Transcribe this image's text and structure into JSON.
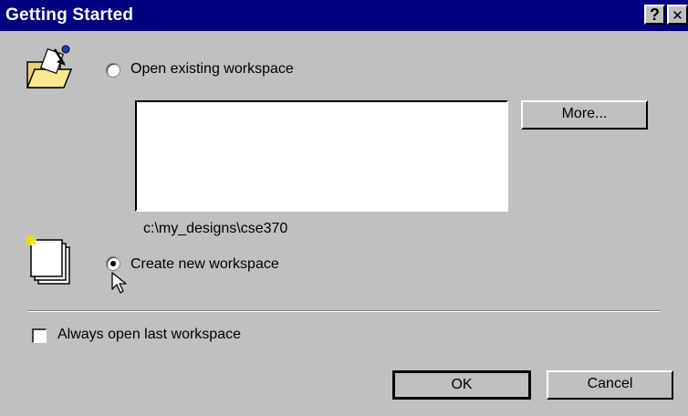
{
  "window": {
    "title": "Getting Started",
    "help_glyph": "?",
    "close_glyph": "✕"
  },
  "open_existing": {
    "icon": "open-folder-icon",
    "radio_label": "Open existing workspace",
    "selected": false,
    "more_button": "More...",
    "path": "c:\\my_designs\\cse370"
  },
  "create_new": {
    "icon": "new-workspace-icon",
    "radio_label": "Create new workspace",
    "selected": true
  },
  "always_open": {
    "label": "Always open last workspace",
    "checked": false
  },
  "buttons": {
    "ok": "OK",
    "cancel": "Cancel"
  },
  "colors": {
    "titlebar": "#000080",
    "face": "#c0c0c0"
  }
}
